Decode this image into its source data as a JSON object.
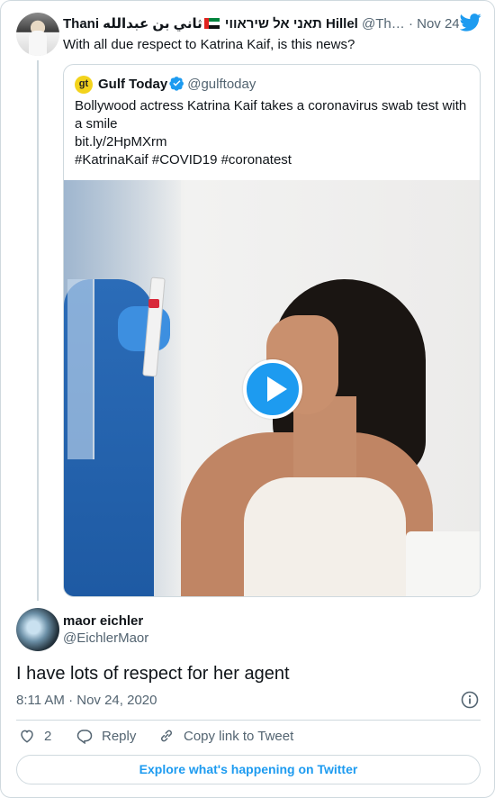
{
  "parent_tweet": {
    "display_name": "Thani תאני אל שיראווי",
    "display_name_arabic": "ثاني بن عبدالله",
    "display_name_end": "Hillel",
    "handle": "@Th…",
    "separator": "·",
    "date": "Nov 24, 2020",
    "text": "With all due respect to Katrina Kaif, is this news?",
    "icons": [
      "uae-flag-icon",
      "twitter-bird-icon"
    ]
  },
  "quoted_tweet": {
    "logo_text": "gt",
    "display_name": "Gulf Today",
    "handle": "@gulftoday",
    "text_lines": [
      "Bollywood actress Katrina Kaif takes a coronavirus swab test with a smile",
      "bit.ly/2HpMXrm",
      "#KatrinaKaif #COVID19 #coronatest"
    ],
    "media_type": "video",
    "icons": [
      "verified-badge-icon",
      "play-icon"
    ]
  },
  "reply_tweet": {
    "display_name": "maor eichler",
    "handle": "@EichlerMaor",
    "text": "I have lots of respect for her agent",
    "timestamp": "8:11 AM · Nov 24, 2020"
  },
  "actions": {
    "like_count": "2",
    "reply_label": "Reply",
    "copy_link_label": "Copy link to Tweet"
  },
  "explore_button_label": "Explore what's happening on Twitter",
  "colors": {
    "accent": "#1d9bf0",
    "secondary_text": "#536471",
    "border": "#cfd9de"
  }
}
